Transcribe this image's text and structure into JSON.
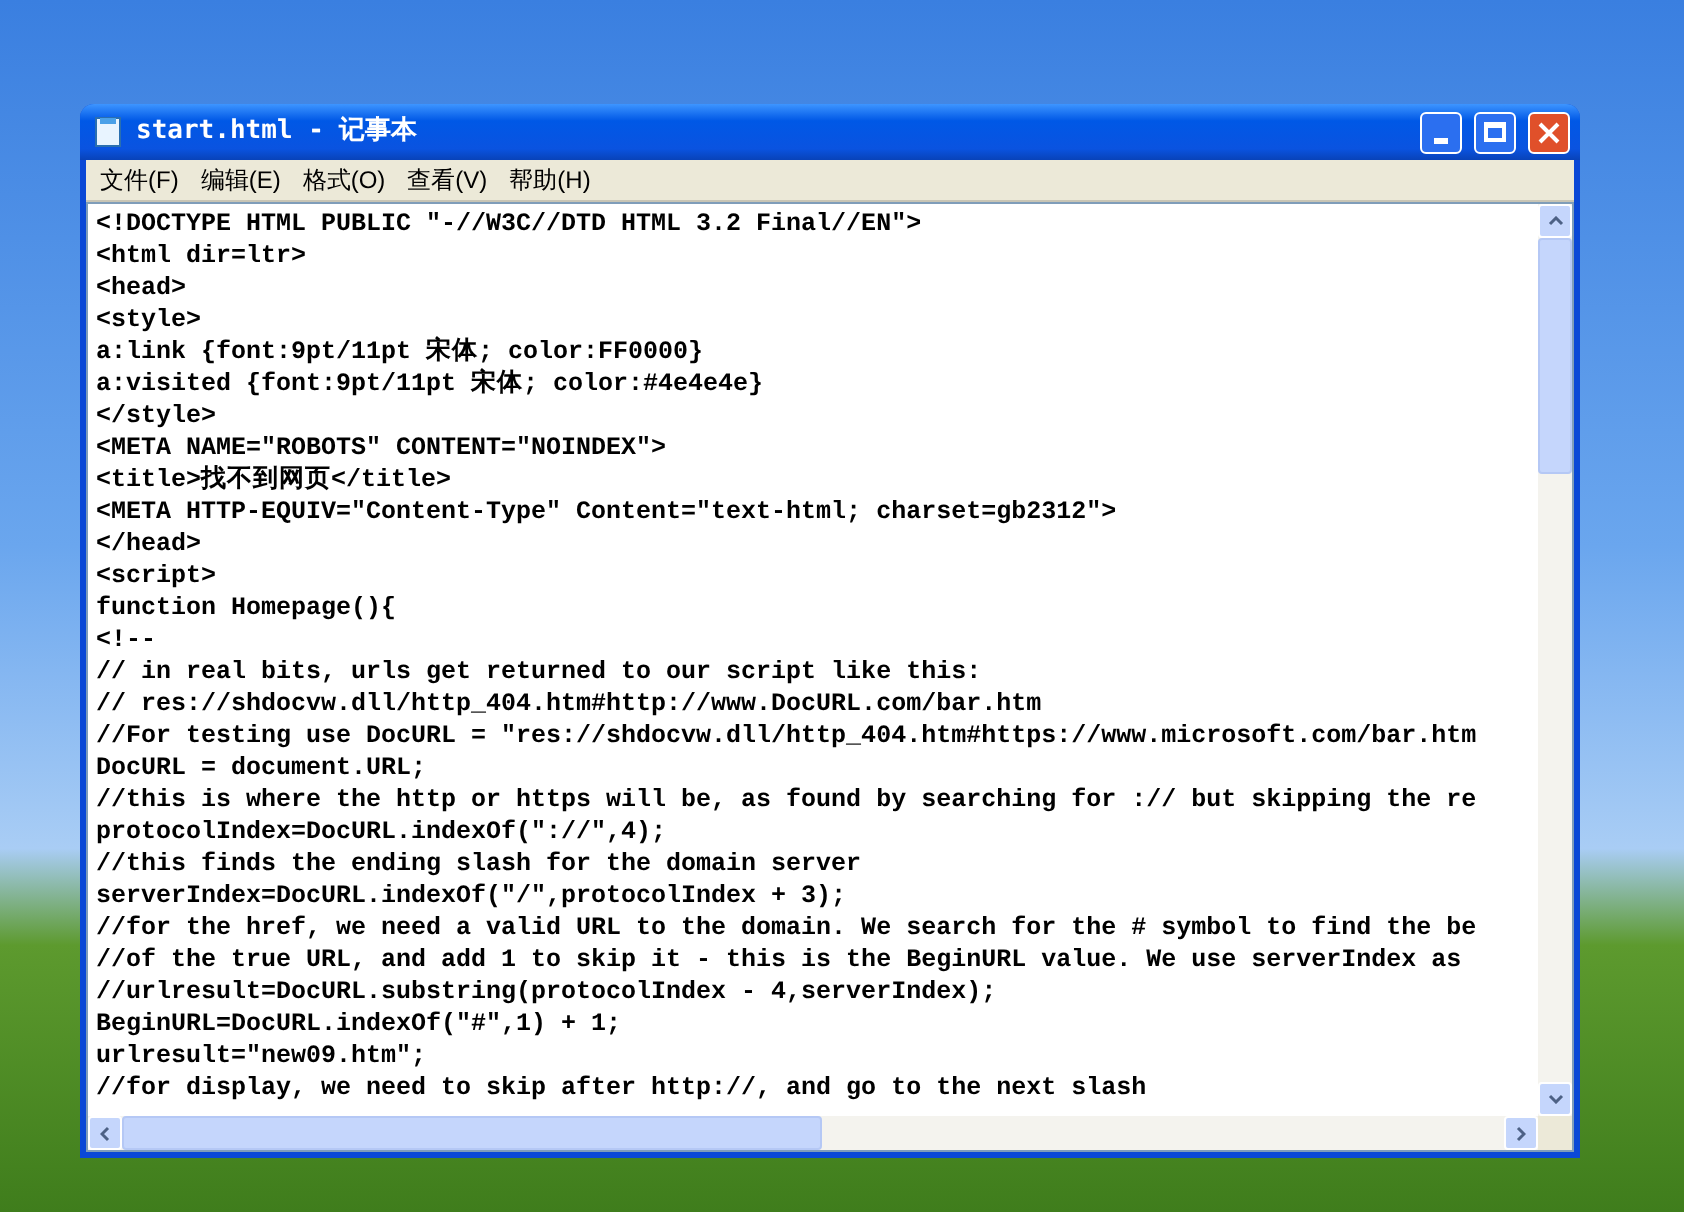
{
  "window": {
    "title": "start.html - 记事本"
  },
  "menu": [
    {
      "label": "文件(F)"
    },
    {
      "label": "编辑(E)"
    },
    {
      "label": "格式(O)"
    },
    {
      "label": "查看(V)"
    },
    {
      "label": "帮助(H)"
    }
  ],
  "editor": {
    "lines": [
      "<!DOCTYPE HTML PUBLIC \"-//W3C//DTD HTML 3.2 Final//EN\">",
      "<html dir=ltr>",
      "<head>",
      "<style>",
      "a:link {font:9pt/11pt 宋体; color:FF0000}",
      "a:visited {font:9pt/11pt 宋体; color:#4e4e4e}",
      "</style>",
      "<META NAME=\"ROBOTS\" CONTENT=\"NOINDEX\">",
      "<title>找不到网页</title>",
      "<META HTTP-EQUIV=\"Content-Type\" Content=\"text-html; charset=gb2312\">",
      "</head>",
      "<script>",
      "function Homepage(){",
      "<!--",
      "// in real bits, urls get returned to our script like this:",
      "// res://shdocvw.dll/http_404.htm#http://www.DocURL.com/bar.htm",
      "//For testing use DocURL = \"res://shdocvw.dll/http_404.htm#https://www.microsoft.com/bar.htm",
      "DocURL = document.URL;",
      "//this is where the http or https will be, as found by searching for :// but skipping the re",
      "protocolIndex=DocURL.indexOf(\"://\",4);",
      "//this finds the ending slash for the domain server",
      "serverIndex=DocURL.indexOf(\"/\",protocolIndex + 3);",
      "//for the href, we need a valid URL to the domain. We search for the # symbol to find the be",
      "//of the true URL, and add 1 to skip it - this is the BeginURL value. We use serverIndex as",
      "//urlresult=DocURL.substring(protocolIndex - 4,serverIndex);",
      "BeginURL=DocURL.indexOf(\"#\",1) + 1;",
      "urlresult=\"new09.htm\";",
      "//for display, we need to skip after http://, and go to the next slash"
    ]
  }
}
